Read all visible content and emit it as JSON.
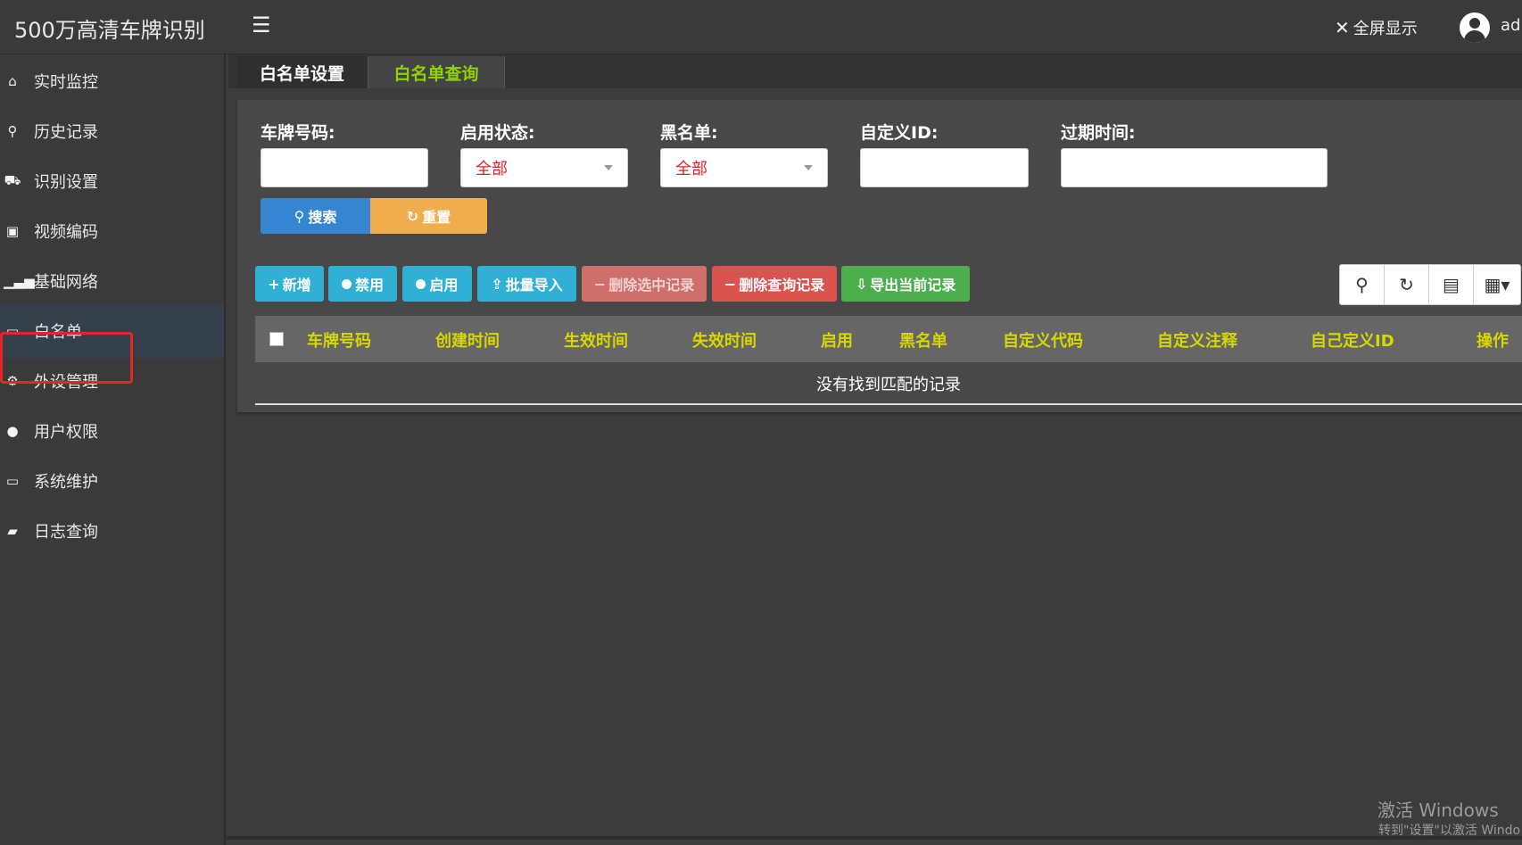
{
  "app": {
    "title": "500万高清车牌识别",
    "fullscreen_label": "全屏显示",
    "username": "adı"
  },
  "sidebar": {
    "items": [
      {
        "label": "实时监控",
        "icon": "home-icon"
      },
      {
        "label": "历史记录",
        "icon": "search-icon"
      },
      {
        "label": "识别设置",
        "icon": "car-icon"
      },
      {
        "label": "视频编码",
        "icon": "video-file-icon"
      },
      {
        "label": "基础网络",
        "icon": "signal-icon"
      },
      {
        "label": "白名单",
        "icon": "calendar-icon"
      },
      {
        "label": "外设管理",
        "icon": "gears-icon"
      },
      {
        "label": "用户权限",
        "icon": "user-icon"
      },
      {
        "label": "系统维护",
        "icon": "monitor-icon"
      },
      {
        "label": "日志查询",
        "icon": "book-icon"
      }
    ],
    "active_index": 5
  },
  "tabs": [
    {
      "label": "白名单设置"
    },
    {
      "label": "白名单查询"
    }
  ],
  "active_tab": 1,
  "filters": {
    "plate": {
      "label": "车牌号码:",
      "value": ""
    },
    "enable_status": {
      "label": "启用状态:",
      "value": "全部"
    },
    "blacklist": {
      "label": "黑名单:",
      "value": "全部"
    },
    "custom_id": {
      "label": "自定义ID:",
      "value": ""
    },
    "expire_time": {
      "label": "过期时间:",
      "value": ""
    }
  },
  "buttons": {
    "search": "搜索",
    "reset": "重置"
  },
  "toolbar": {
    "add": "新增",
    "disable": "禁用",
    "enable": "启用",
    "import": "批量导入",
    "delete_selected": "删除选中记录",
    "delete_query": "删除查询记录",
    "export": "导出当前记录"
  },
  "table": {
    "columns": [
      "车牌号码",
      "创建时间",
      "生效时间",
      "失效时间",
      "启用",
      "黑名单",
      "自定义代码",
      "自定义注释",
      "自己定义ID",
      "操作"
    ],
    "empty_text": "没有找到匹配的记录"
  },
  "watermark": {
    "line1": "激活 Windows",
    "line2": "转到\"设置\"以激活 Windo"
  },
  "colors": {
    "tab_active": "#8ed400",
    "header_text": "#d8d800",
    "accent_blue": "#31b0d5"
  }
}
